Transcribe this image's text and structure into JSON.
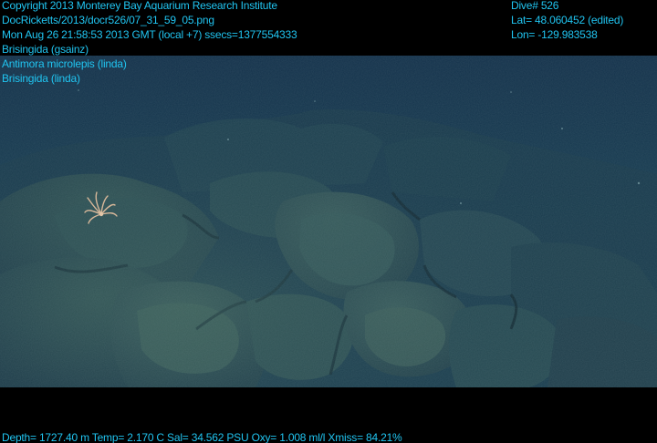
{
  "header": {
    "copyright": "Copyright 2013 Monterey Bay Aquarium Research Institute",
    "image_path": "DocRicketts/2013/docr526/07_31_59_05.png",
    "datetime": "Mon Aug 26 21:58:53 2013 GMT (local +7)  ssecs=1377554333",
    "dive": "Dive# 526",
    "lat": "Lat= 48.060452 (edited)",
    "lon": "Lon= -129.983538"
  },
  "annotations": [
    "Brisingida (gsainz)",
    "Antimora microlepis (linda)",
    "Brisingida (linda)"
  ],
  "footer": {
    "telemetry": "Depth= 1727.40 m  Temp= 2.170 C  Sal= 34.562 PSU  Oxy= 1.008 ml/l  Xmiss= 84.21%"
  },
  "colors": {
    "overlay_text": "#20c4f0",
    "background": "#000000",
    "water_top": "#14304a",
    "rock": "#2c4d55"
  }
}
